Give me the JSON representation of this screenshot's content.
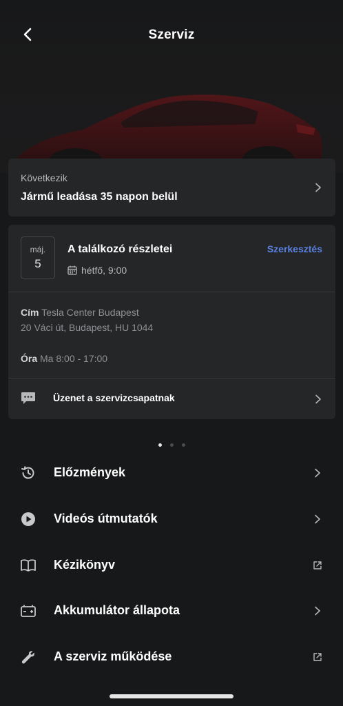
{
  "header": {
    "title": "Szerviz",
    "back_icon": "chevron-left-icon"
  },
  "next": {
    "label": "Következik",
    "title": "Jármű leadása 35 napon belül"
  },
  "appointment": {
    "month": "máj.",
    "day": "5",
    "title": "A találkozó részletei",
    "edit_label": "Szerkesztés",
    "time": "hétfő, 9:00",
    "address_key": "Cím",
    "address_line1": "Tesla Center Budapest",
    "address_line2": "20 Váci út, Budapest, HU 1044",
    "hours_key": "Óra",
    "hours_value": "Ma 8:00 - 17:00",
    "message_label": "Üzenet a szervizcsapatnak"
  },
  "pager": {
    "count": 3,
    "active": 0
  },
  "menu": [
    {
      "label": "Előzmények",
      "icon": "history-icon",
      "action": "chevron"
    },
    {
      "label": "Videós útmutatók",
      "icon": "play-icon",
      "action": "chevron"
    },
    {
      "label": "Kézikönyv",
      "icon": "book-icon",
      "action": "external"
    },
    {
      "label": "Akkumulátor állapota",
      "icon": "battery-icon",
      "action": "chevron"
    },
    {
      "label": "A szerviz működése",
      "icon": "wrench-icon",
      "action": "external"
    }
  ],
  "colors": {
    "background": "#171819",
    "card": "#252628",
    "accent": "#5b80e0",
    "car": "#7a1a1f"
  }
}
